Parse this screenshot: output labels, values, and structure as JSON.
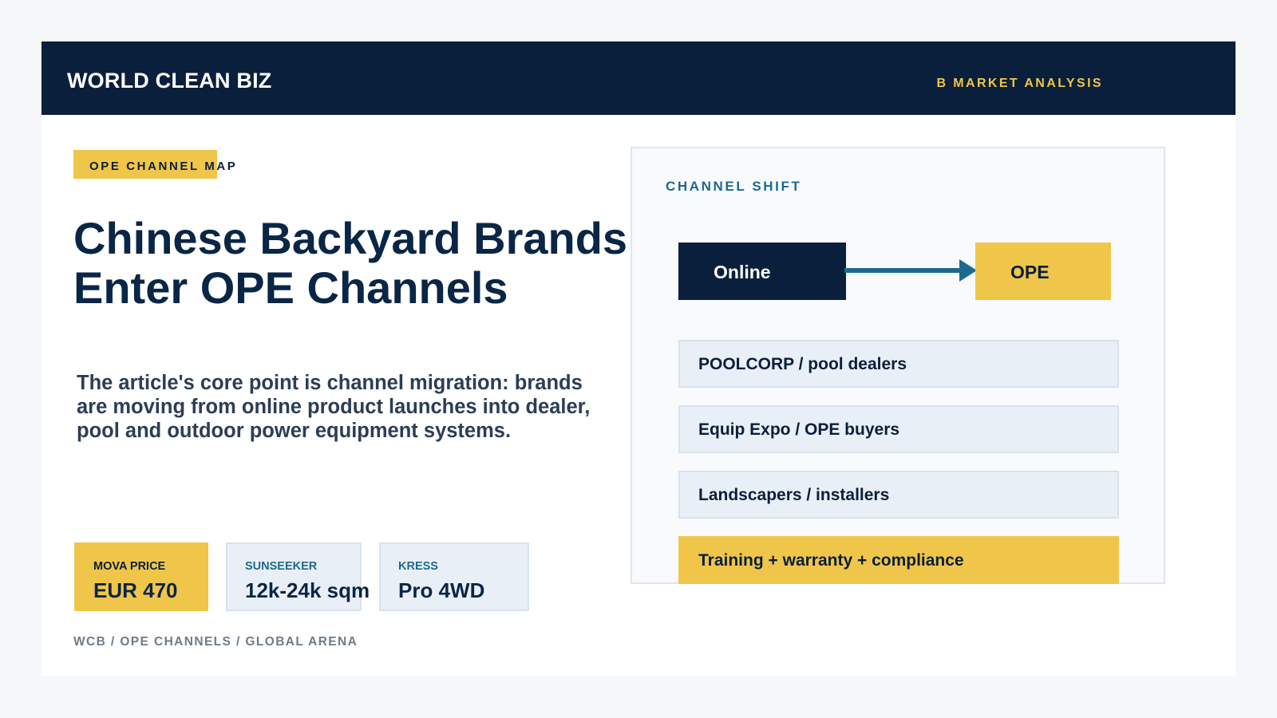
{
  "header": {
    "brand": "WORLD CLEAN BIZ",
    "section": "B MARKET ANALYSIS"
  },
  "main": {
    "kicker": "OPE CHANNEL MAP",
    "title_line1": "Chinese Backyard Brands",
    "title_line2": "Enter OPE Channels",
    "lede": "The article's core point is channel migration: brands are moving from online product launches into dealer, pool and outdoor power equipment systems.",
    "stats": [
      {
        "label": "MOVA PRICE",
        "value": "EUR 470"
      },
      {
        "label": "SUNSEEKER",
        "value": "12k-24k sqm"
      },
      {
        "label": "KRESS",
        "value": "Pro 4WD"
      }
    ],
    "footer": "WCB / OPE CHANNELS / GLOBAL ARENA"
  },
  "panel": {
    "title": "CHANNEL SHIFT",
    "from": "Online",
    "to": "OPE",
    "rows": [
      "POOLCORP / pool dealers",
      "Equip Expo / OPE buyers",
      "Landscapers / installers",
      "Training + warranty + compliance"
    ]
  },
  "colors": {
    "navy": "#0a1f3b",
    "gold": "#f0c64a",
    "teal": "#1e6a8f",
    "light": "#e9eff6"
  }
}
